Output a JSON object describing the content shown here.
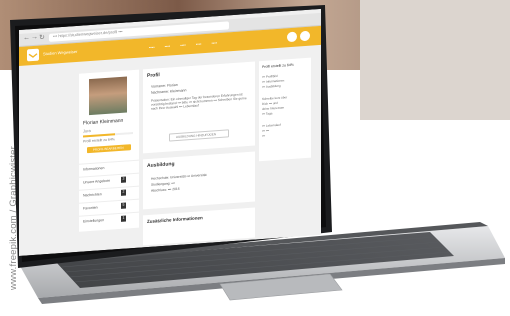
{
  "watermark": "www.freepik.com / Graphicwister",
  "browser": {
    "url": "••• https://studienwegweiser.de/profil •••"
  },
  "app": {
    "logo_text": "Studien Wegweiser",
    "nav": [
      "••••",
      "••••",
      "••••",
      "••••",
      "••••"
    ]
  },
  "profile": {
    "name": "Florian Kleinmann",
    "subtitle": "Jura",
    "progress_label": "Profil erstellt zu 64%",
    "progress": 0.64,
    "button_label": "PROFIL BEARBEITEN"
  },
  "sidebar_items": [
    {
      "label": "Informationen",
      "badge": ""
    },
    {
      "label": "Unsere Angebote",
      "badge": "3"
    },
    {
      "label": "Nachrichten",
      "badge": "2"
    },
    {
      "label": "Favoriten",
      "badge": "5"
    },
    {
      "label": "Einstellungen",
      "badge": "1"
    }
  ],
  "main": {
    "profil_heading": "Profil",
    "profil_lines": [
      "Vorname: Florian",
      "Nachname: Kleinmann"
    ],
    "profil_text": "Präsentation: Ein einmaliger Tag der besonderen Erfahrungen ist vorsichtig bestand ••• bitte ••• sicht kommen ••• Schreiben Sie gerne nach Ihrer Auswahl ••• Lebenslauf",
    "profil_button": "AUSBILDUNG HINZUFÜGEN",
    "ausbildung_heading": "Ausbildung",
    "ausbildung_lines": [
      "Hochschule: Universität ••• Universität",
      "Studiengang: •••",
      "Abschluss: ••• 2016"
    ],
    "zusatz_heading": "Zusätzliche Informationen"
  },
  "right_panel": {
    "heading": "Profil erstellt zu 64%",
    "checks": [
      "••• Profilbild",
      "••• Informationen",
      "••• Ausbildung"
    ],
    "block1": [
      "Schreibe kurz über",
      "Dich ••• und",
      "deine Interessen",
      "••• Tage."
    ],
    "block2": [
      "••• Lebenslauf",
      "••• •••",
      "•••"
    ]
  },
  "colors": {
    "accent": "#f2b72a",
    "screen_bg": "#f0f0f0",
    "aluminium": "#c9cbcd"
  }
}
